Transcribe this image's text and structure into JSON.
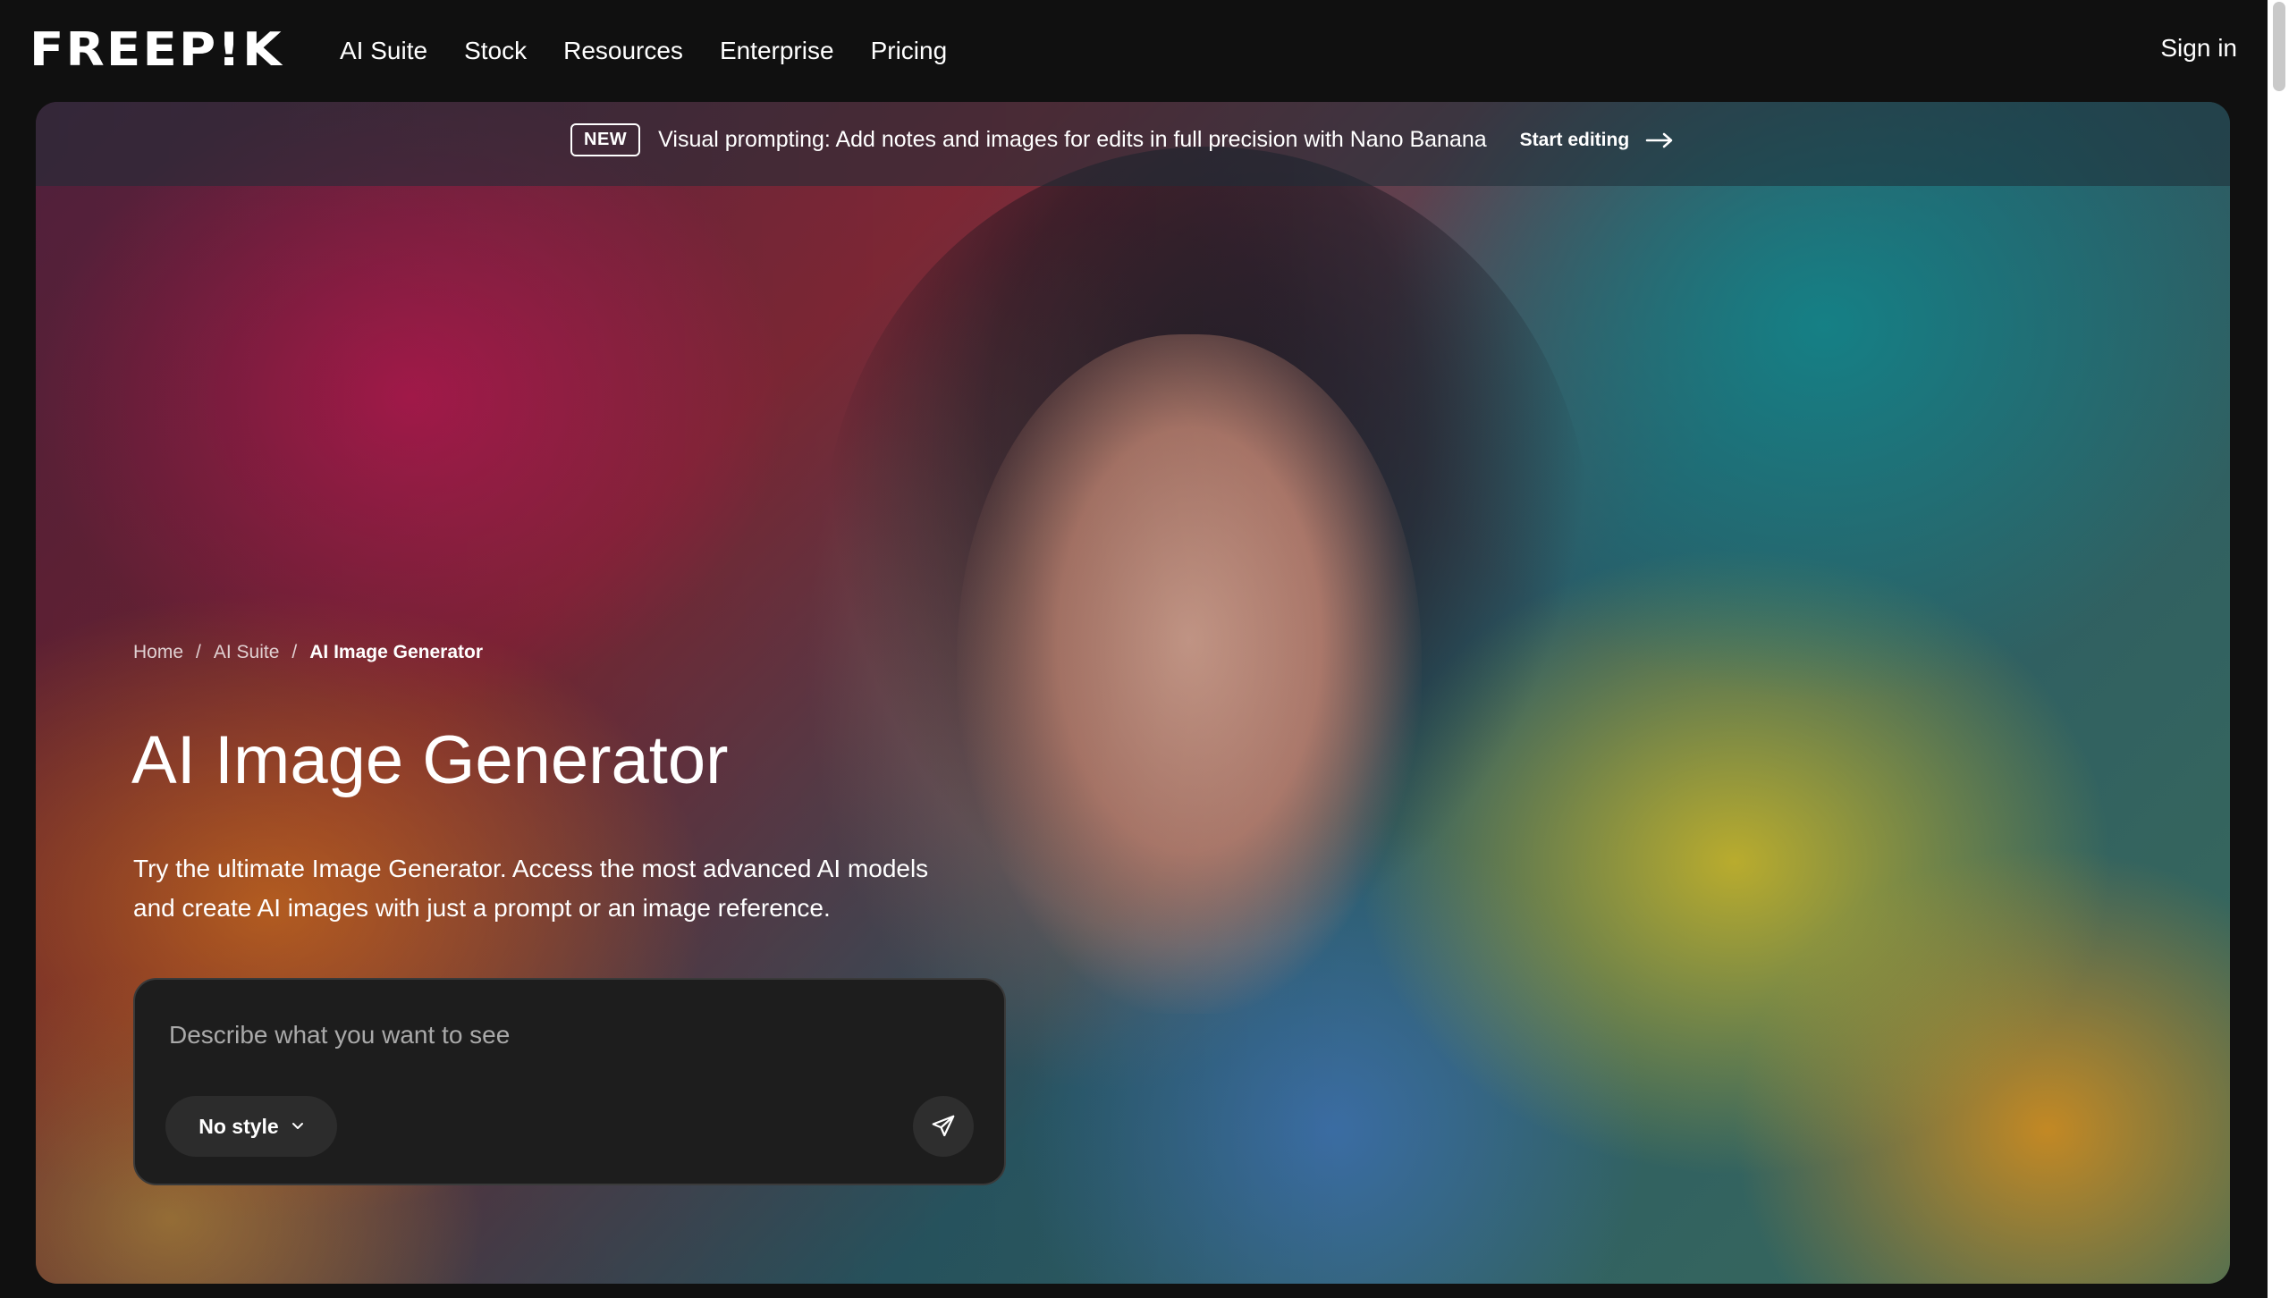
{
  "nav": {
    "logo": "FREEP!K",
    "links": [
      "AI Suite",
      "Stock",
      "Resources",
      "Enterprise",
      "Pricing"
    ],
    "sign_in": "Sign in"
  },
  "announcement": {
    "badge": "NEW",
    "text": "Visual prompting: Add notes and images for edits in full precision with Nano Banana",
    "cta": "Start editing"
  },
  "breadcrumb": {
    "items": [
      "Home",
      "AI Suite"
    ],
    "current": "AI Image Generator",
    "separator": "/"
  },
  "hero": {
    "title": "AI Image Generator",
    "subtitle": "Try the ultimate Image Generator. Access the most advanced AI models and create AI images with just a prompt or an image reference."
  },
  "prompt": {
    "placeholder": "Describe what you want to see",
    "style_label": "No style"
  },
  "icons": {
    "arrow": "arrow-right-icon",
    "chevron": "chevron-down-icon",
    "send": "send-icon"
  }
}
